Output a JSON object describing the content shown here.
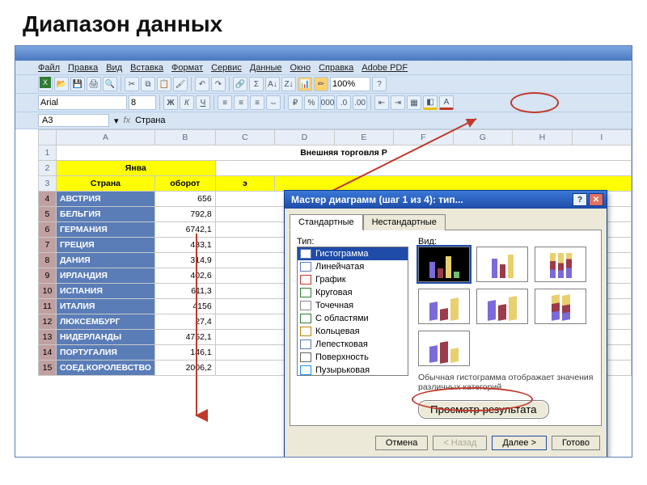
{
  "slide": {
    "title": "Диапазон данных"
  },
  "menu": [
    "Файл",
    "Правка",
    "Вид",
    "Вставка",
    "Формат",
    "Сервис",
    "Данные",
    "Окно",
    "Справка",
    "Adobe PDF"
  ],
  "toolbar": {
    "font": "Arial",
    "size": "8",
    "zoom": "100%"
  },
  "namebox": {
    "ref": "A3",
    "formula_label": "fx",
    "formula_value": "Страна"
  },
  "columns": [
    "A",
    "B",
    "C",
    "D",
    "E",
    "F",
    "G",
    "H",
    "I"
  ],
  "sheet_title": "Внешняя торговля Р",
  "month_header": "Янва",
  "header_row": {
    "country": "Страна",
    "turnover": "оборот",
    "extra": "э"
  },
  "rows": [
    {
      "n": 4,
      "country": "АВСТРИЯ",
      "value": "656"
    },
    {
      "n": 5,
      "country": "БЕЛЬГИЯ",
      "value": "792,8"
    },
    {
      "n": 6,
      "country": "ГЕРМАНИЯ",
      "value": "6742,1"
    },
    {
      "n": 7,
      "country": "ГРЕЦИЯ",
      "value": "433,1"
    },
    {
      "n": 8,
      "country": "ДАНИЯ",
      "value": "314,9"
    },
    {
      "n": 9,
      "country": "ИРЛАНДИЯ",
      "value": "402,6"
    },
    {
      "n": 10,
      "country": "ИСПАНИЯ",
      "value": "611,3"
    },
    {
      "n": 11,
      "country": "ИТАЛИЯ",
      "value": "4156"
    },
    {
      "n": 12,
      "country": "ЛЮКСЕМБУРГ",
      "value": "27,4"
    },
    {
      "n": 13,
      "country": "НИДЕРЛАНДЫ",
      "value": "4752,1"
    },
    {
      "n": 14,
      "country": "ПОРТУГАЛИЯ",
      "value": "146,1"
    },
    {
      "n": 15,
      "country": "СОЕД.КОРОЛЕВСТВО",
      "value": "2006,2"
    }
  ],
  "dialog": {
    "title": "Мастер диаграмм (шаг 1 из 4): тип...",
    "tab_standard": "Стандартные",
    "tab_custom": "Нестандартные",
    "type_label": "Тип:",
    "view_label": "Вид:",
    "types": [
      "Гистограмма",
      "Линейчатая",
      "График",
      "Круговая",
      "Точечная",
      "С областями",
      "Кольцевая",
      "Лепестковая",
      "Поверхность",
      "Пузырьковая"
    ],
    "desc": "Обычная гистограмма отображает значения различных категорий.",
    "preview": "Просмотр результата",
    "cancel": "Отмена",
    "back": "< Назад",
    "next": "Далее >",
    "finish": "Готово"
  },
  "icons": {
    "bold": "Ж",
    "italic": "К",
    "underline": "Ч",
    "percent": "%",
    "sum": "Σ",
    "help": "?"
  }
}
